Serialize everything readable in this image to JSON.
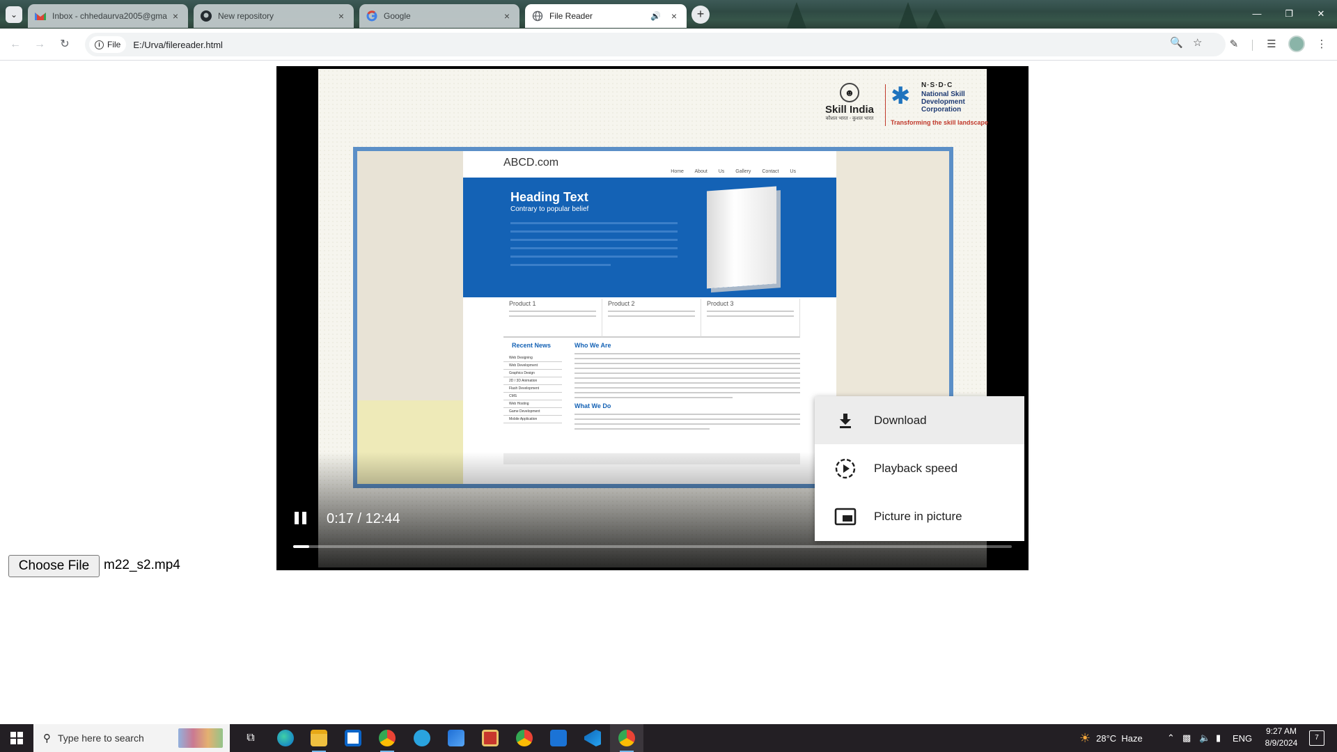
{
  "browser": {
    "tabs": [
      {
        "title": "Inbox - chhedaurva2005@gma",
        "favicon": "gmail-icon",
        "active": false
      },
      {
        "title": "New repository",
        "favicon": "github-icon",
        "active": false
      },
      {
        "title": "Google",
        "favicon": "google-icon",
        "active": false
      },
      {
        "title": "File Reader",
        "favicon": "globe-icon",
        "active": true,
        "audio": true
      }
    ],
    "new_tab_label": "+",
    "toolbar": {
      "chip_label": "File",
      "url": "E:/Urva/filereader.html"
    }
  },
  "video_player": {
    "time_display": "0:17 / 12:44",
    "progress": 0.022,
    "state": "playing",
    "frame": {
      "logos": {
        "skill_india": "Skill India",
        "skill_india_sub": "कौशल भारत - कुशल भारत",
        "nsdc_acronym": "N·S·D·C",
        "nsdc_name": "National Skill Development Corporation",
        "nsdc_tagline": "Transforming the skill landscape"
      },
      "site": {
        "brand": "ABCD.com",
        "menu": "Home About Us Gallery Contact Us",
        "heading": "Heading Text",
        "subheading": "Contrary to popular belief",
        "products": [
          "Product 1",
          "Product 2",
          "Product 3"
        ],
        "recent_news_title": "Recent News",
        "recent_news": [
          "Web Designing",
          "Web Development",
          "Graphics Design",
          "2D / 3D Animation",
          "Flash Development",
          "CMS",
          "Web Hosting",
          "Game Development",
          "Mobile Application"
        ],
        "who_we_are_title": "Who We Are",
        "what_we_do_title": "What We Do"
      }
    }
  },
  "context_menu": {
    "items": [
      {
        "label": "Download",
        "icon": "download-icon",
        "hovered": true
      },
      {
        "label": "Playback speed",
        "icon": "playback-speed-icon",
        "hovered": false
      },
      {
        "label": "Picture in picture",
        "icon": "picture-in-picture-icon",
        "hovered": false
      }
    ]
  },
  "file_input": {
    "button_label": "Choose File",
    "file_name": "m22_s2.mp4"
  },
  "taskbar": {
    "search_placeholder": "Type here to search",
    "weather": "28°C  Haze",
    "language": "ENG",
    "time": "9:27 AM",
    "date": "8/9/2024",
    "notification_count": "7"
  },
  "colors": {
    "accent_blue": "#1462b5",
    "taskbar": "#231f24",
    "progress": "#ffffff"
  }
}
